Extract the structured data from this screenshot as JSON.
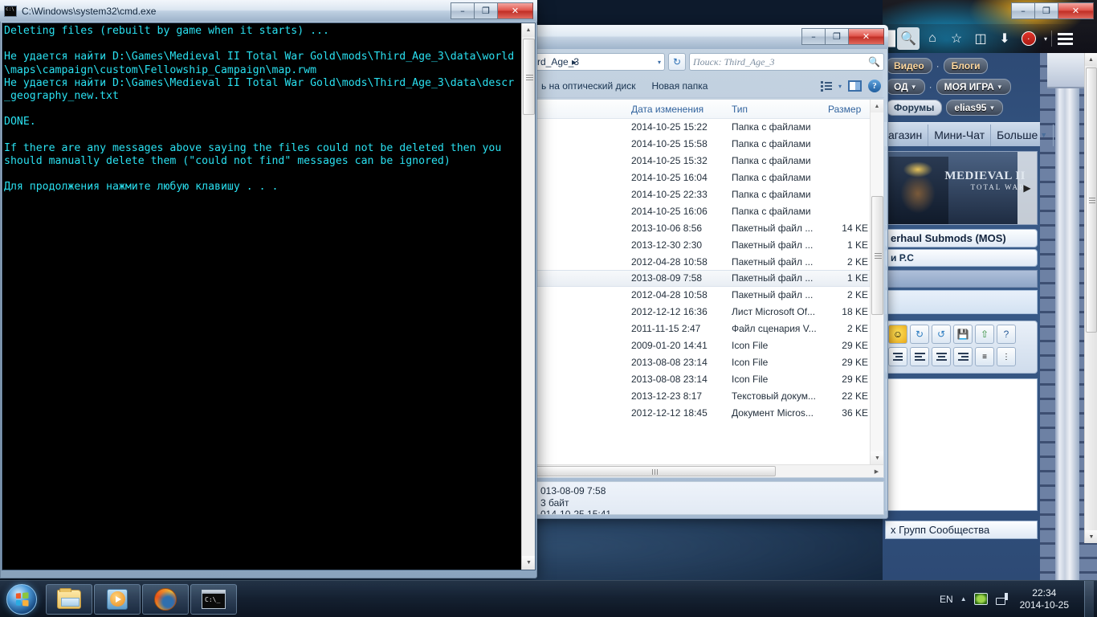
{
  "desktop": {
    "wallpaper_tone": "#16283f"
  },
  "cmd": {
    "title": "C:\\Windows\\system32\\cmd.exe",
    "icon": "cmd-icon",
    "text_color": "#2ae0f0",
    "lines": [
      "Deleting files (rebuilt by game when it starts) ...",
      "",
      "Не удается найти D:\\Games\\Medieval II Total War Gold\\mods\\Third_Age_3\\data\\world",
      "\\maps\\campaign\\custom\\Fellowship_Campaign\\map.rwm",
      "Не удается найти D:\\Games\\Medieval II Total War Gold\\mods\\Third_Age_3\\data\\descr",
      "_geography_new.txt",
      "",
      "DONE.",
      "",
      "If there are any messages above saying the files could not be deleted then you",
      "should manually delete them (\"could not find\" messages can be ignored)",
      "",
      "Для продолжения нажмите любую клавишу . . ."
    ],
    "window_buttons": {
      "minimize": "–",
      "maximize": "❐",
      "close": "✕"
    }
  },
  "explorer": {
    "address": {
      "crumb": "rd_Age_3",
      "crumb_arrow": "▸",
      "dropdown": "▾",
      "refresh": "↻"
    },
    "search": {
      "placeholder": "Поиск: Third_Age_3",
      "icon": "search-icon"
    },
    "commandbar": {
      "items": [
        "ь на оптический диск",
        "Новая папка"
      ],
      "view_icon": "view-list-icon",
      "view_caret": "▾",
      "preview_icon": "preview-pane-icon",
      "help_icon": "help-icon",
      "help_glyph": "?"
    },
    "columns": [
      "",
      "Дата изменения",
      "Тип",
      "Размер"
    ],
    "rows": [
      {
        "name": "",
        "date": "2014-10-25 15:22",
        "type": "Папка с файлами",
        "size": "",
        "selected": false
      },
      {
        "name": "",
        "date": "2014-10-25 15:58",
        "type": "Папка с файлами",
        "size": "",
        "selected": false
      },
      {
        "name": "",
        "date": "2014-10-25 15:32",
        "type": "Папка с файлами",
        "size": "",
        "selected": false
      },
      {
        "name": "",
        "date": "2014-10-25 16:04",
        "type": "Папка с файлами",
        "size": "",
        "selected": false
      },
      {
        "name": "",
        "date": "2014-10-25 22:33",
        "type": "Папка с файлами",
        "size": "",
        "selected": false
      },
      {
        "name": "",
        "date": "2014-10-25 16:06",
        "type": "Папка с файлами",
        "size": "",
        "selected": false
      },
      {
        "name": "",
        "date": "2013-10-06 8:56",
        "type": "Пакетный файл ...",
        "size": "14 KE",
        "selected": false
      },
      {
        "name": "",
        "date": "2013-12-30 2:30",
        "type": "Пакетный файл ...",
        "size": "1 KE",
        "selected": false
      },
      {
        "name": "",
        "date": "2012-04-28 10:58",
        "type": "Пакетный файл ...",
        "size": "2 KE",
        "selected": false
      },
      {
        "name": "",
        "date": "2013-08-09 7:58",
        "type": "Пакетный файл ...",
        "size": "1 KE",
        "selected": true
      },
      {
        "name": "",
        "date": "2012-04-28 10:58",
        "type": "Пакетный файл ...",
        "size": "2 KE",
        "selected": false
      },
      {
        "name": "",
        "date": "2012-12-12 16:36",
        "type": "Лист Microsoft Of...",
        "size": "18 KE",
        "selected": false
      },
      {
        "name": "",
        "date": "2011-11-15 2:47",
        "type": "Файл сценария V...",
        "size": "2 KE",
        "selected": false
      },
      {
        "name": "",
        "date": "2009-01-20 14:41",
        "type": "Icon File",
        "size": "29 KE",
        "selected": false
      },
      {
        "name": "",
        "date": "2013-08-08 23:14",
        "type": "Icon File",
        "size": "29 KE",
        "selected": false
      },
      {
        "name": "",
        "date": "2013-08-08 23:14",
        "type": "Icon File",
        "size": "29 KE",
        "selected": false
      },
      {
        "name": "",
        "date": "2013-12-23 8:17",
        "type": "Текстовый докум...",
        "size": "22 KE",
        "selected": false
      },
      {
        "name": "",
        "date": "2012-12-12 18:45",
        "type": "Документ Micros...",
        "size": "36 KE",
        "selected": false
      }
    ],
    "details": [
      "013-08-09 7:58",
      "3 байт",
      "014-10-25 15:41"
    ],
    "window_buttons": {
      "minimize": "–",
      "maximize": "❐",
      "close": "✕"
    }
  },
  "firefox": {
    "window_buttons": {
      "minimize": "–",
      "maximize": "❐",
      "close": "✕"
    },
    "toolbar_icons": [
      "search-icon",
      "home-icon",
      "bookmark-star-icon",
      "library-icon",
      "downloads-icon",
      "adblock-icon",
      "menu-icon"
    ],
    "adblock_label": "ABP",
    "page": {
      "nav_pills": [
        "Видео",
        "Блоги"
      ],
      "nav_sep": "·",
      "menu_pills": [
        "ОД",
        "МОЯ ИГРА"
      ],
      "account_pills": [
        "Форумы",
        "elias95"
      ],
      "tabs": [
        "агазин",
        "Мини-Чат",
        "Больше"
      ],
      "hero": {
        "line1": "MEDIEVAL II",
        "line2": "TOTAL WAR",
        "arrow": "▶"
      },
      "thread_title": "erhaul Submods (MOS)",
      "thread_sub": "и      Р.С",
      "footer_text": "х Групп Сообщества",
      "editor_tools_row1": [
        "smiley-icon",
        "redo-icon",
        "undo-icon",
        "save-icon",
        "upload-icon",
        "help-icon"
      ],
      "editor_tools_row2": [
        "indent-icon",
        "align-left-icon",
        "align-center-icon",
        "align-right-icon",
        "ordered-list-icon",
        "bullet-list-icon"
      ]
    }
  },
  "taskbar": {
    "start": "start-orb",
    "buttons": [
      "explorer-taskbar-icon",
      "media-player-taskbar-icon",
      "firefox-taskbar-icon",
      "cmd-taskbar-icon"
    ],
    "tray": {
      "language": "EN",
      "expand_caret": "▲",
      "icons": [
        "nvidia-icon",
        "network-icon"
      ],
      "time": "22:34",
      "date": "2014-10-25"
    }
  }
}
